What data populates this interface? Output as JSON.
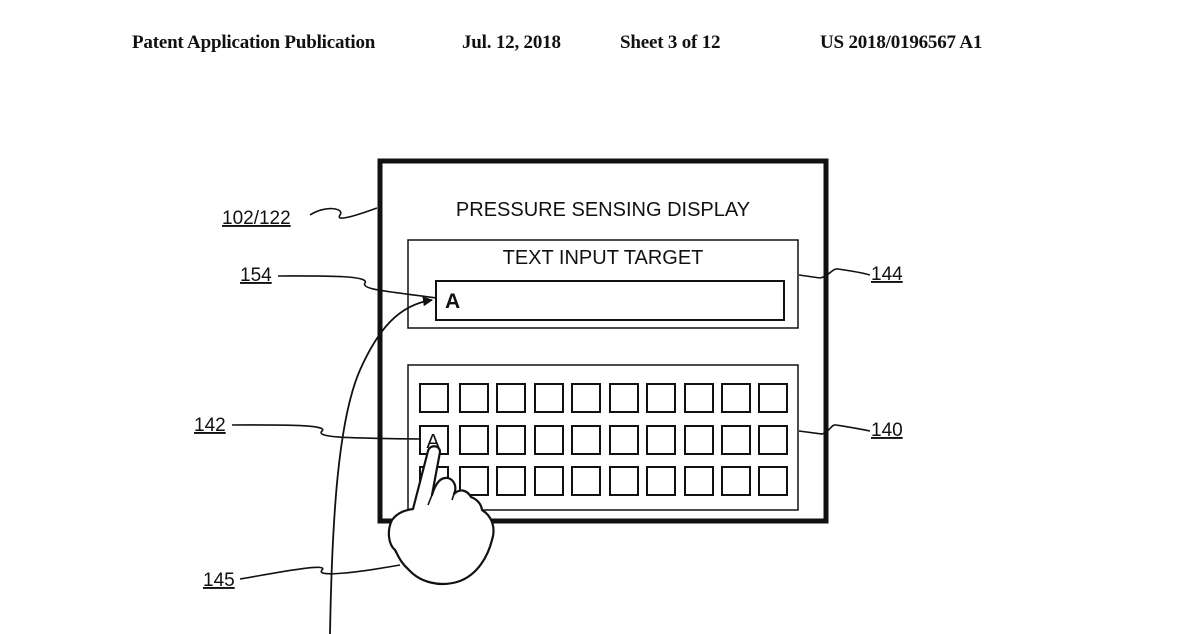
{
  "header": {
    "publication": "Patent Application Publication",
    "date": "Jul. 12, 2018",
    "sheet": "Sheet 3 of 12",
    "number": "US 2018/0196567 A1"
  },
  "figure": {
    "display_title": "PRESSURE SENSING DISPLAY",
    "text_input_title": "TEXT INPUT TARGET",
    "text_input_value": "A",
    "pressed_key_label": "A",
    "keyboard": {
      "rows": 3,
      "columns": 10
    },
    "reference_labels": {
      "display": "102/122",
      "text_input_region": "144",
      "inserted_character": "154",
      "key": "142",
      "keyboard": "140",
      "gesture_path": "145"
    }
  }
}
